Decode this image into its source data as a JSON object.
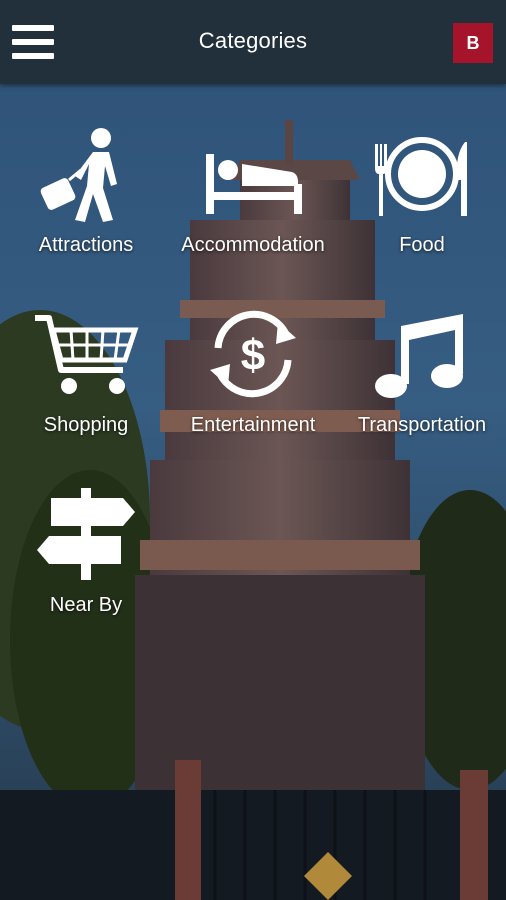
{
  "app": {
    "title": "Categories",
    "badge_letter": "B",
    "accent_color": "#a5142a",
    "header_color": "#22303c"
  },
  "categories": [
    {
      "label": "Attractions",
      "icon": "traveler-suitcase-icon"
    },
    {
      "label": "Accommodation",
      "icon": "bed-icon"
    },
    {
      "label": "Food",
      "icon": "plate-fork-knife-icon"
    },
    {
      "label": "Shopping",
      "icon": "shopping-cart-icon"
    },
    {
      "label": "Entertainment",
      "icon": "dollar-exchange-icon"
    },
    {
      "label": "Transportation",
      "icon": "music-note-icon"
    },
    {
      "label": "Near By",
      "icon": "signpost-icon"
    }
  ]
}
